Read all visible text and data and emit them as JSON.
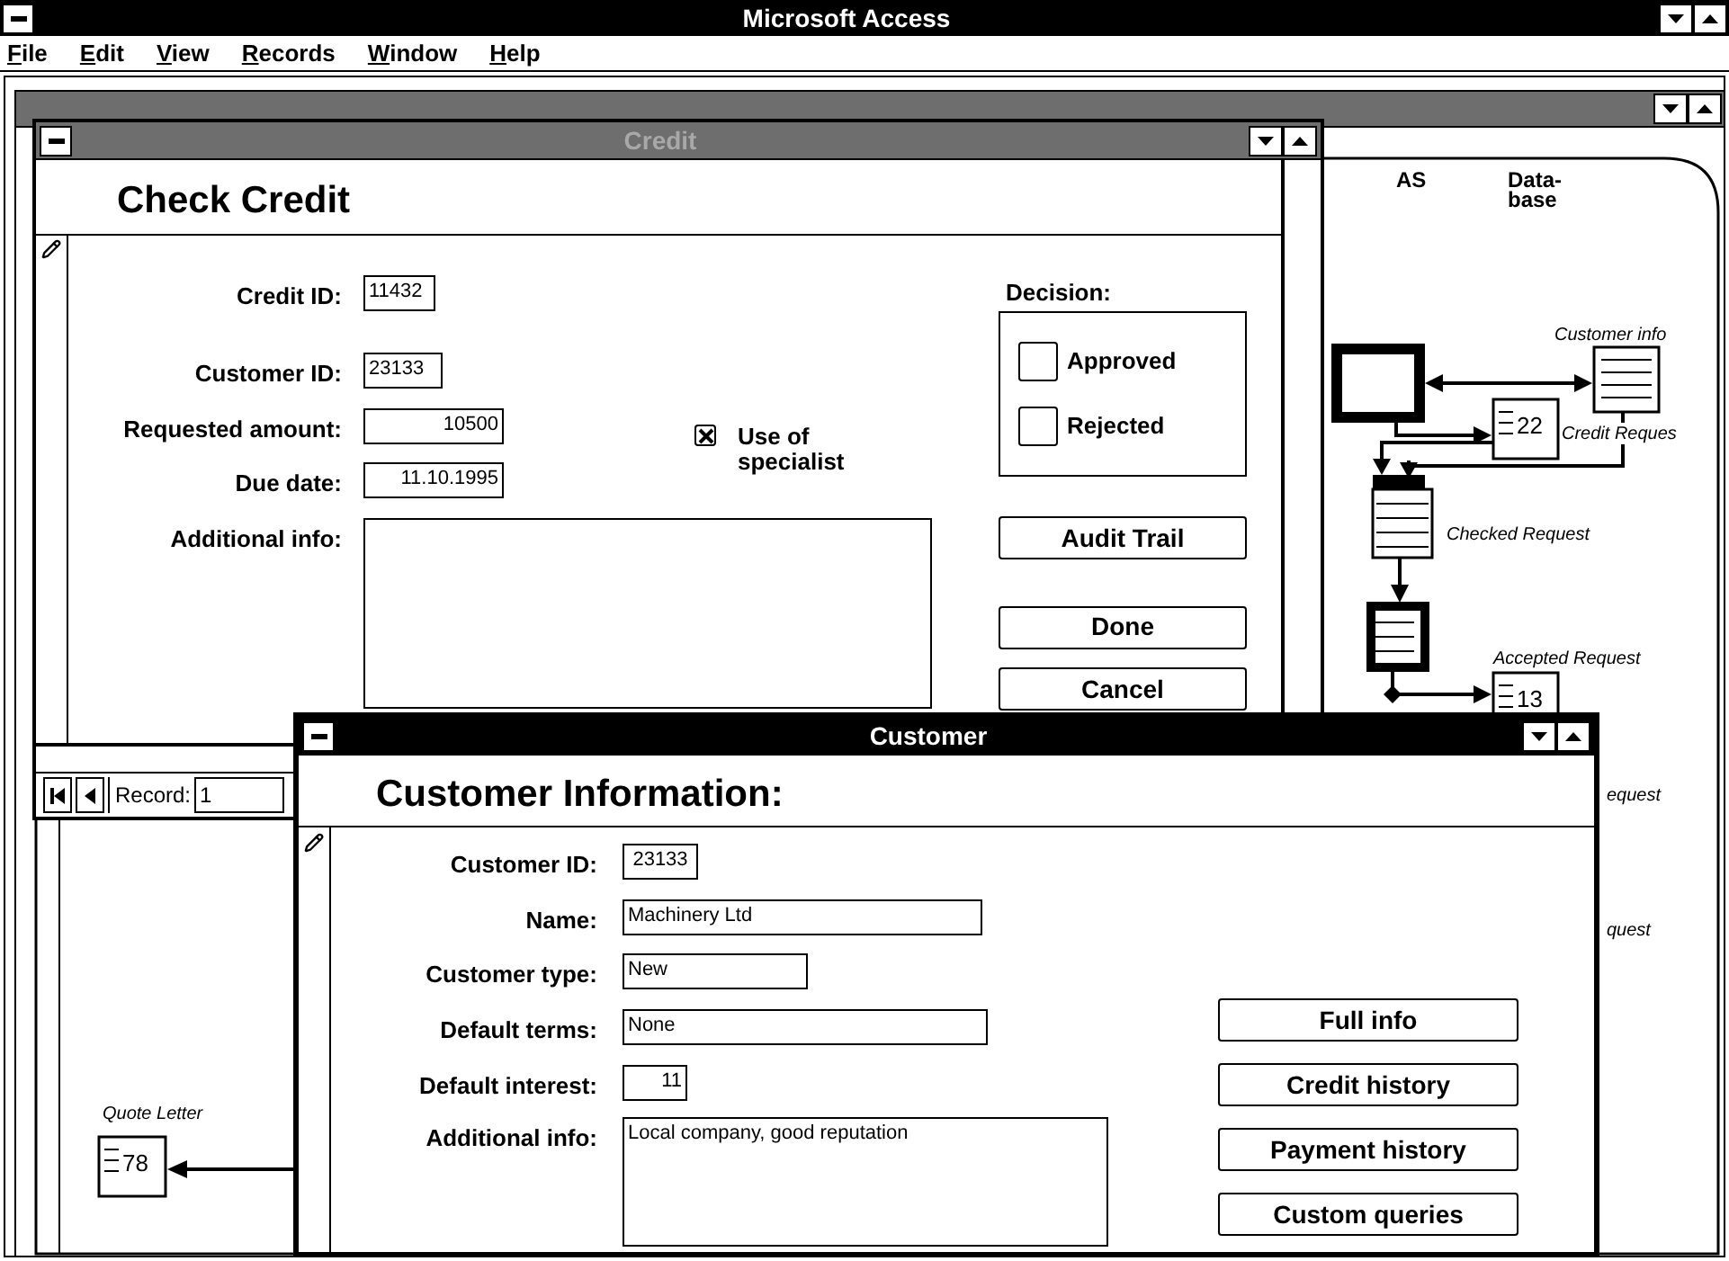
{
  "app_window": {
    "title": "Microsoft Access"
  },
  "menu": [
    "File",
    "Edit",
    "View",
    "Records",
    "Window",
    "Help"
  ],
  "diagram": {
    "headings": [
      "AS",
      "Data-\nbase"
    ],
    "nodes": [
      {
        "kind": "document",
        "caption": "Customer info"
      },
      {
        "kind": "document",
        "count": "22",
        "caption": "Credit Reques"
      },
      {
        "kind": "store",
        "caption": "Checked Request"
      },
      {
        "kind": "document",
        "count": "13",
        "caption": "Accepted Request"
      },
      {
        "kind": "label",
        "caption": "equest"
      },
      {
        "kind": "label",
        "caption": "quest"
      },
      {
        "kind": "document",
        "count": "78",
        "caption": "Quote Letter"
      }
    ]
  },
  "credit_window": {
    "title": "Credit",
    "active": false,
    "heading": "Check Credit",
    "fields": [
      {
        "label": "Credit ID:",
        "value": "11432"
      },
      {
        "label": "Customer ID:",
        "value": "23133"
      },
      {
        "label": "Requested amount:",
        "value": "10500"
      },
      {
        "label": "Due date:",
        "value": "11.10.1995"
      },
      {
        "label": "Additional info:"
      }
    ],
    "specialist": {
      "label": "Use of\nspecialist",
      "checked": true
    },
    "decision": {
      "label": "Decision:",
      "options": [
        {
          "label": "Approved",
          "checked": false
        },
        {
          "label": "Rejected",
          "checked": false
        }
      ]
    },
    "buttons": [
      "Audit Trail",
      "Done",
      "Cancel"
    ],
    "record": {
      "label": "Record:",
      "value": "1"
    }
  },
  "customer_window": {
    "title": "Customer",
    "active": true,
    "heading": "Customer Information:",
    "fields": [
      {
        "label": "Customer ID:",
        "value": "23133"
      },
      {
        "label": "Name:",
        "value": "Machinery Ltd"
      },
      {
        "label": "Customer type:",
        "value": "New"
      },
      {
        "label": "Default terms:",
        "value": "None"
      },
      {
        "label": "Default interest:",
        "value": "11"
      },
      {
        "label": "Additional info:",
        "value": "Local company, good reputation"
      }
    ],
    "buttons": [
      "Full info",
      "Credit history",
      "Payment history",
      "Custom queries"
    ]
  }
}
